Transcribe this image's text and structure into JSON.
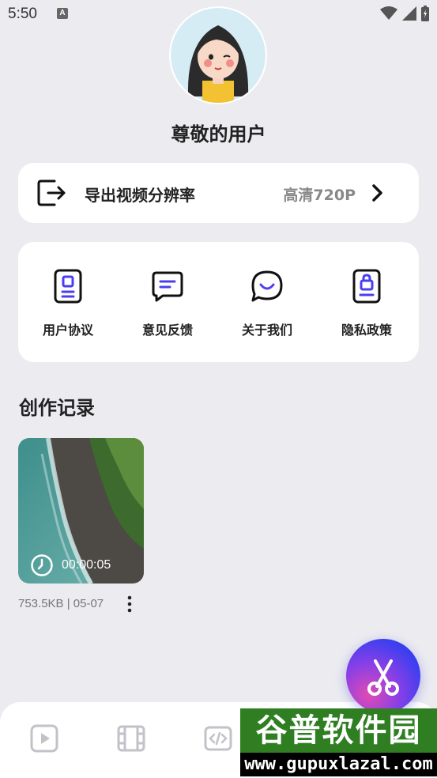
{
  "status_bar": {
    "time": "5:50",
    "notification_glyph": "A"
  },
  "profile": {
    "username": "尊敬的用户"
  },
  "export_setting": {
    "label": "导出视频分辨率",
    "value": "高清720P"
  },
  "links": [
    {
      "label": "用户协议",
      "icon": "user-agreement-icon"
    },
    {
      "label": "意见反馈",
      "icon": "feedback-icon"
    },
    {
      "label": "关于我们",
      "icon": "about-us-icon"
    },
    {
      "label": "隐私政策",
      "icon": "privacy-policy-icon"
    }
  ],
  "records": {
    "title": "创作记录",
    "items": [
      {
        "duration": "00:00:05",
        "meta": "753.5KB | 05-07"
      }
    ]
  },
  "bottom_nav": [
    "video-play-icon",
    "film-strip-icon",
    "code-icon"
  ],
  "watermark": {
    "top": "谷普软件园",
    "bottom": "www.gupuxlazal.com"
  },
  "colors": {
    "accent": "#4a3ff0",
    "background": "#ebebf0",
    "card": "#ffffff"
  }
}
